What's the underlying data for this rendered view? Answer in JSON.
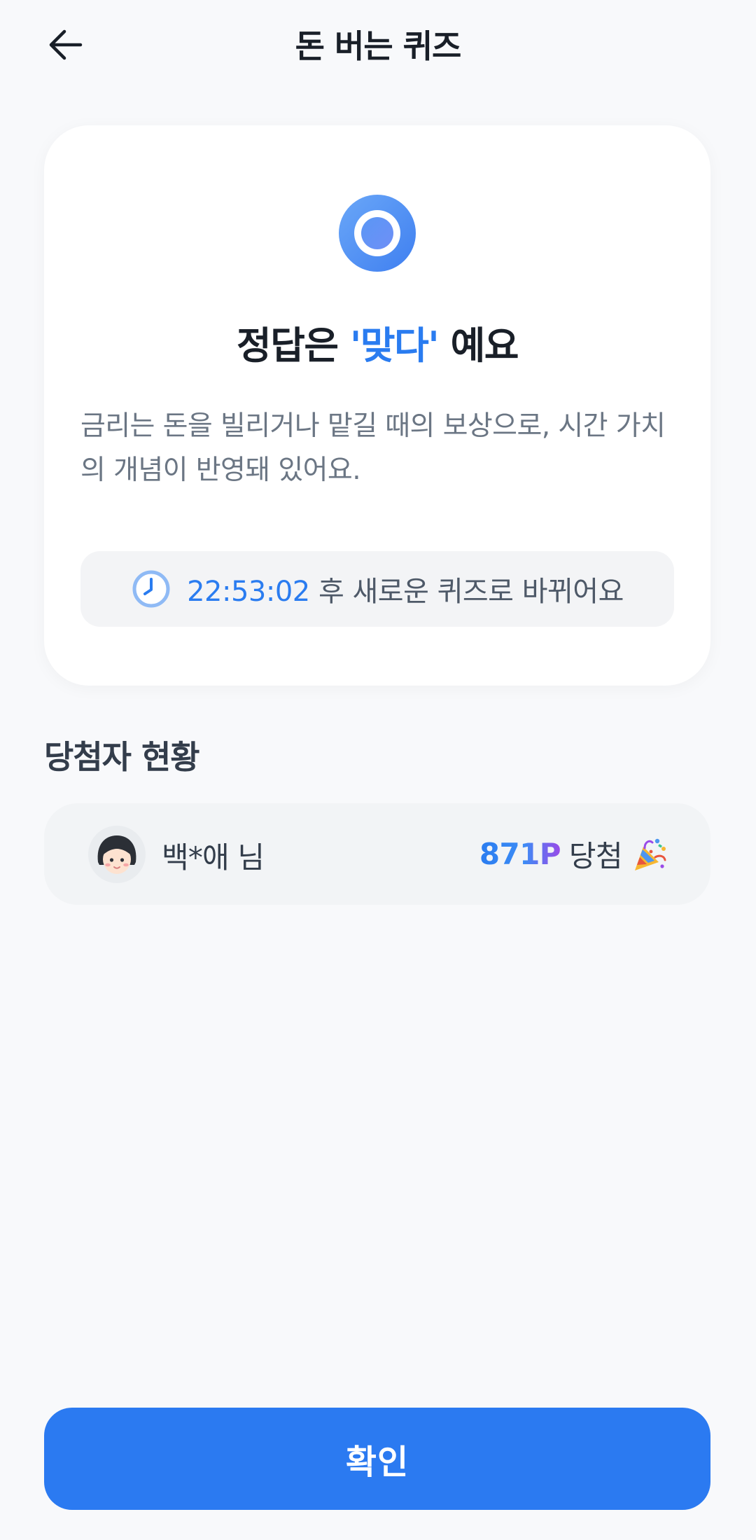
{
  "header": {
    "title": "돈 버는 퀴즈",
    "back_icon": "arrow-left-icon"
  },
  "answer": {
    "icon": "correct-circle-icon",
    "title_prefix": "정답은 ",
    "answer_text": "'맞다'",
    "title_suffix": " 예요",
    "explanation": "금리는 돈을 빌리거나 맡길 때의 보상으로, 시간 가치의 개념이 반영돼 있어요.",
    "timer": {
      "icon": "clock-icon",
      "time": "22:53:02",
      "suffix": " 후 새로운 퀴즈로 바뀌어요"
    }
  },
  "winners": {
    "title": "당첨자 현황",
    "items": [
      {
        "avatar_icon": "avatar-girl-icon",
        "name": "백*애 님",
        "amount": "871P",
        "label": "당첨",
        "icon": "party-popper-icon"
      }
    ]
  },
  "confirm_label": "확인",
  "colors": {
    "primary": "#2b7af1",
    "background": "#f8f9fb",
    "card": "#ffffff",
    "gray_box": "#f2f4f6",
    "accent_purple": "#9a4ae8"
  }
}
